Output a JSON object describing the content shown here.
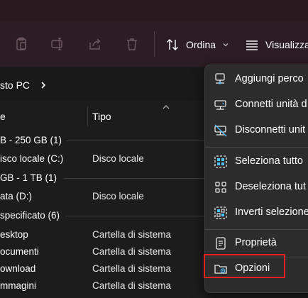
{
  "toolbar": {
    "sort_label": "Ordina",
    "view_label": "Visualizza"
  },
  "breadcrumb": {
    "current": "sto PC"
  },
  "columns": {
    "name": "e",
    "type": "Tipo"
  },
  "groups": [
    {
      "label": "B - 250 GB (1)"
    },
    {
      "label": "GB - 1 TB (1)"
    },
    {
      "label": "specificato (6)"
    }
  ],
  "rows": [
    {
      "name": "isco locale (C:)",
      "type": "Disco locale"
    },
    {
      "name": "ata (D:)",
      "type": "Disco locale"
    },
    {
      "name": "esktop",
      "type": "Cartella di sistema"
    },
    {
      "name": "ocumenti",
      "type": "Cartella di sistema"
    },
    {
      "name": "ownload",
      "type": "Cartella di sistema"
    },
    {
      "name": "mmagini",
      "type": "Cartella di sistema"
    }
  ],
  "menu": {
    "items": [
      {
        "label": "Aggiungi perco",
        "icon": "add-network-location-icon"
      },
      {
        "label": "Connetti unità d",
        "icon": "map-network-drive-icon"
      },
      {
        "label": "Disconnetti unit",
        "icon": "disconnect-network-drive-icon"
      },
      {
        "label": "Seleziona tutto",
        "icon": "select-all-icon"
      },
      {
        "label": "Deseleziona tut",
        "icon": "select-none-icon"
      },
      {
        "label": "Inverti selezione",
        "icon": "invert-selection-icon"
      },
      {
        "label": "Proprietà",
        "icon": "properties-icon"
      },
      {
        "label": "Opzioni",
        "icon": "options-folder-icon"
      }
    ]
  },
  "colors": {
    "highlight": "#e2231a",
    "accent_blue": "#4cc2ff",
    "background": "#1c1c1c",
    "menu_bg": "#2c2c2c"
  }
}
